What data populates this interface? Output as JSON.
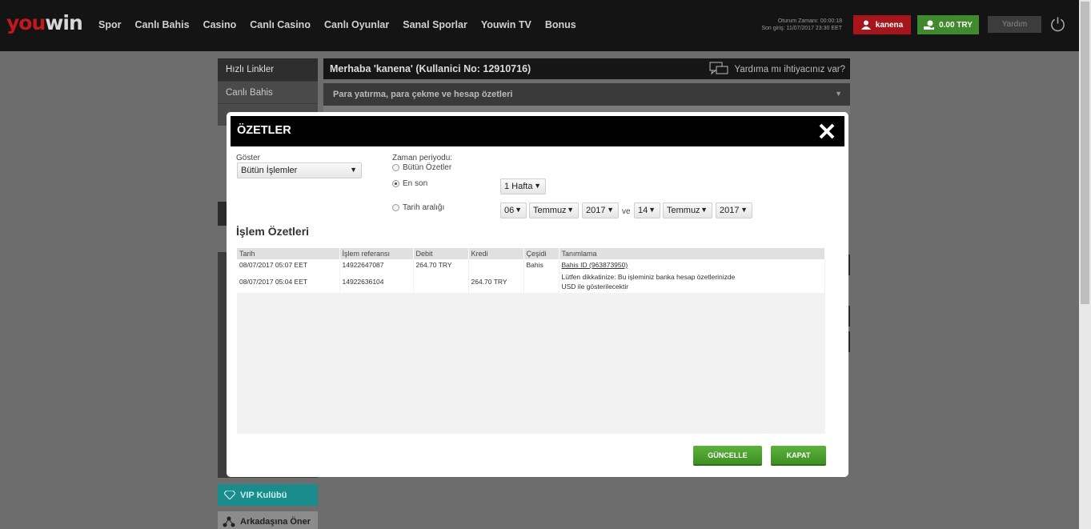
{
  "header": {
    "logo_you": "you",
    "logo_win": "win",
    "nav": [
      "Spor",
      "Canlı Bahis",
      "Casino",
      "Canlı Casino",
      "Canlı Oyunlar",
      "Sanal Sporlar",
      "Youwin TV",
      "Bonus"
    ],
    "session_time": "Oturum Zamanı: 00:00:18",
    "last_login": "Son giriş: 11/07/2017 23:30 EET",
    "username": "kanena",
    "balance": "0.00 TRY",
    "help": "Yardım"
  },
  "sidebar": {
    "title": "Hızlı Linkler",
    "items": [
      "Canlı Bahis"
    ],
    "vip": "VIP Kulübü",
    "share": "Arkadaşına Öner"
  },
  "main": {
    "greeting": "Merhaba 'kanena' (Kullanici No: 12910716)",
    "help_question": "Yardıma mı ihtiyacınız var?",
    "subtitle": "Para yatırma, para çekme ve hesap özetleri"
  },
  "modal": {
    "title": "ÖZETLER",
    "show_label": "Göster",
    "show_value": "Bütün İşlemler",
    "period_label": "Zaman periyodu:",
    "radio_all": "Bütün Özetler",
    "radio_latest": "En son",
    "radio_range": "Tarih aralığı",
    "latest_value": "1 Hafta",
    "range": {
      "from_day": "06",
      "from_month": "Temmuz",
      "from_year": "2017",
      "and": "ve",
      "to_day": "14",
      "to_month": "Temmuz",
      "to_year": "2017"
    },
    "section_title": "İşlem Özetleri",
    "columns": [
      "Tarih",
      "İşlem referansı",
      "Debit",
      "Kredi",
      "Çeşidi",
      "Tanımlama"
    ],
    "rows": [
      {
        "date": "08/07/2017 05:07 EET",
        "ref": "14922647087",
        "debit": "264.70 TRY",
        "credit": "",
        "type": "Bahis",
        "desc": "Bahis ID (963873950)"
      },
      {
        "date": "08/07/2017 05:04 EET",
        "ref": "14922636104",
        "debit": "",
        "credit": "264.70 TRY",
        "type": "",
        "desc": "Lütfen dikkatinize: Bu işleminiz banka hesap özetlerinizde USD ile gösterilecektir"
      }
    ],
    "update_button": "GÜNCELLE",
    "close_button": "KAPAT"
  }
}
